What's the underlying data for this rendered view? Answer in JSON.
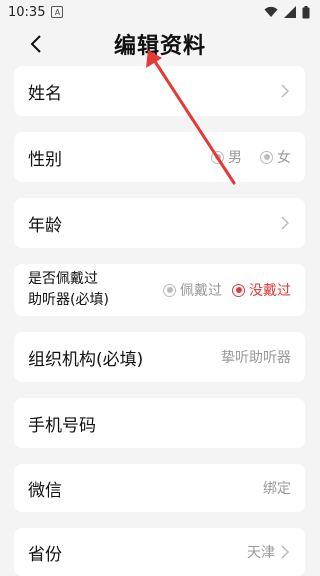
{
  "status_bar": {
    "time": "10:35",
    "app_badge": "A"
  },
  "header": {
    "title": "编辑资料",
    "back_icon": "chevron-left-icon"
  },
  "annotation": {
    "color": "#e53935"
  },
  "colors": {
    "accent": "#e03a3a",
    "muted": "#999999",
    "background": "#f4f4f4"
  },
  "form": {
    "name_label": "姓名",
    "gender_label": "性别",
    "gender_options": [
      "男",
      "女"
    ],
    "age_label": "年龄",
    "hearing_aid_label_line1": "是否佩戴过",
    "hearing_aid_label_line2": "助听器(必填)",
    "hearing_aid_options": [
      "佩戴过",
      "没戴过"
    ],
    "hearing_aid_selected": "没戴过",
    "organization_label": "组织机构(必填)",
    "organization_value": "挚听助听器",
    "phone_label": "手机号码",
    "wechat_label": "微信",
    "wechat_value": "绑定",
    "province_label": "省份",
    "province_value": "天津"
  }
}
